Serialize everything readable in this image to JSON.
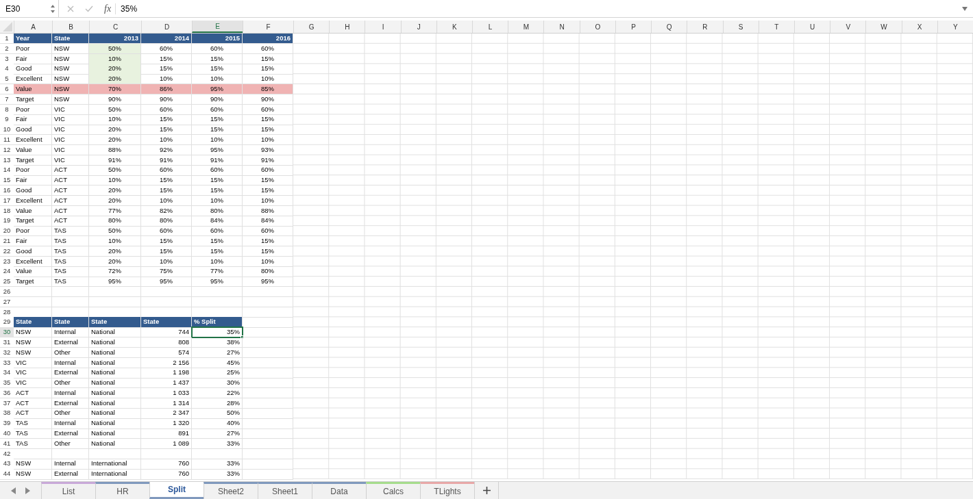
{
  "formula_bar": {
    "name_box": "E30",
    "function_label": "fx",
    "value": "35%"
  },
  "columns": [
    {
      "label": "A",
      "selected": false
    },
    {
      "label": "B",
      "selected": false
    },
    {
      "label": "C",
      "selected": false
    },
    {
      "label": "D",
      "selected": false
    },
    {
      "label": "E",
      "selected": true
    },
    {
      "label": "F",
      "selected": false
    },
    {
      "label": "G",
      "selected": false
    },
    {
      "label": "H",
      "selected": false
    },
    {
      "label": "I",
      "selected": false
    },
    {
      "label": "J",
      "selected": false
    },
    {
      "label": "K",
      "selected": false
    },
    {
      "label": "L",
      "selected": false
    },
    {
      "label": "M",
      "selected": false
    },
    {
      "label": "N",
      "selected": false
    },
    {
      "label": "O",
      "selected": false
    },
    {
      "label": "P",
      "selected": false
    },
    {
      "label": "Q",
      "selected": false
    },
    {
      "label": "R",
      "selected": false
    },
    {
      "label": "S",
      "selected": false
    },
    {
      "label": "T",
      "selected": false
    },
    {
      "label": "U",
      "selected": false
    },
    {
      "label": "V",
      "selected": false
    },
    {
      "label": "W",
      "selected": false
    },
    {
      "label": "X",
      "selected": false
    },
    {
      "label": "Y",
      "selected": false
    }
  ],
  "rows": [
    {
      "n": "1",
      "kind": "header",
      "c_shaded": false,
      "selected": false,
      "cells": [
        "Year",
        "State",
        "2013",
        "2014",
        "2015",
        "2016"
      ]
    },
    {
      "n": "2",
      "kind": "data",
      "c_shaded": true,
      "selected": false,
      "cells": [
        "Poor",
        "NSW",
        "50%",
        "60%",
        "60%",
        "60%"
      ]
    },
    {
      "n": "3",
      "kind": "data",
      "c_shaded": true,
      "selected": false,
      "cells": [
        "Fair",
        "NSW",
        "10%",
        "15%",
        "15%",
        "15%"
      ]
    },
    {
      "n": "4",
      "kind": "data",
      "c_shaded": true,
      "selected": false,
      "cells": [
        "Good",
        "NSW",
        "20%",
        "15%",
        "15%",
        "15%"
      ]
    },
    {
      "n": "5",
      "kind": "data",
      "c_shaded": true,
      "selected": false,
      "cells": [
        "Excellent",
        "NSW",
        "20%",
        "10%",
        "10%",
        "10%"
      ]
    },
    {
      "n": "6",
      "kind": "highlight",
      "c_shaded": false,
      "selected": false,
      "cells": [
        "Value",
        "NSW",
        "70%",
        "86%",
        "95%",
        "85%"
      ]
    },
    {
      "n": "7",
      "kind": "data",
      "c_shaded": false,
      "selected": false,
      "cells": [
        "Target",
        "NSW",
        "90%",
        "90%",
        "90%",
        "90%"
      ]
    },
    {
      "n": "8",
      "kind": "data",
      "c_shaded": false,
      "selected": false,
      "cells": [
        "Poor",
        "VIC",
        "50%",
        "60%",
        "60%",
        "60%"
      ]
    },
    {
      "n": "9",
      "kind": "data",
      "c_shaded": false,
      "selected": false,
      "cells": [
        "Fair",
        "VIC",
        "10%",
        "15%",
        "15%",
        "15%"
      ]
    },
    {
      "n": "10",
      "kind": "data",
      "c_shaded": false,
      "selected": false,
      "cells": [
        "Good",
        "VIC",
        "20%",
        "15%",
        "15%",
        "15%"
      ]
    },
    {
      "n": "11",
      "kind": "data",
      "c_shaded": false,
      "selected": false,
      "cells": [
        "Excellent",
        "VIC",
        "20%",
        "10%",
        "10%",
        "10%"
      ]
    },
    {
      "n": "12",
      "kind": "data",
      "c_shaded": false,
      "selected": false,
      "cells": [
        "Value",
        "VIC",
        "88%",
        "92%",
        "95%",
        "93%"
      ]
    },
    {
      "n": "13",
      "kind": "data",
      "c_shaded": false,
      "selected": false,
      "cells": [
        "Target",
        "VIC",
        "91%",
        "91%",
        "91%",
        "91%"
      ]
    },
    {
      "n": "14",
      "kind": "data",
      "c_shaded": false,
      "selected": false,
      "cells": [
        "Poor",
        "ACT",
        "50%",
        "60%",
        "60%",
        "60%"
      ]
    },
    {
      "n": "15",
      "kind": "data",
      "c_shaded": false,
      "selected": false,
      "cells": [
        "Fair",
        "ACT",
        "10%",
        "15%",
        "15%",
        "15%"
      ]
    },
    {
      "n": "16",
      "kind": "data",
      "c_shaded": false,
      "selected": false,
      "cells": [
        "Good",
        "ACT",
        "20%",
        "15%",
        "15%",
        "15%"
      ]
    },
    {
      "n": "17",
      "kind": "data",
      "c_shaded": false,
      "selected": false,
      "cells": [
        "Excellent",
        "ACT",
        "20%",
        "10%",
        "10%",
        "10%"
      ]
    },
    {
      "n": "18",
      "kind": "data",
      "c_shaded": false,
      "selected": false,
      "cells": [
        "Value",
        "ACT",
        "77%",
        "82%",
        "80%",
        "88%"
      ]
    },
    {
      "n": "19",
      "kind": "data",
      "c_shaded": false,
      "selected": false,
      "cells": [
        "Target",
        "ACT",
        "80%",
        "80%",
        "84%",
        "84%"
      ]
    },
    {
      "n": "20",
      "kind": "data",
      "c_shaded": false,
      "selected": false,
      "cells": [
        "Poor",
        "TAS",
        "50%",
        "60%",
        "60%",
        "60%"
      ]
    },
    {
      "n": "21",
      "kind": "data",
      "c_shaded": false,
      "selected": false,
      "cells": [
        "Fair",
        "TAS",
        "10%",
        "15%",
        "15%",
        "15%"
      ]
    },
    {
      "n": "22",
      "kind": "data",
      "c_shaded": false,
      "selected": false,
      "cells": [
        "Good",
        "TAS",
        "20%",
        "15%",
        "15%",
        "15%"
      ]
    },
    {
      "n": "23",
      "kind": "data",
      "c_shaded": false,
      "selected": false,
      "cells": [
        "Excellent",
        "TAS",
        "20%",
        "10%",
        "10%",
        "10%"
      ]
    },
    {
      "n": "24",
      "kind": "data",
      "c_shaded": false,
      "selected": false,
      "cells": [
        "Value",
        "TAS",
        "72%",
        "75%",
        "77%",
        "80%"
      ]
    },
    {
      "n": "25",
      "kind": "data",
      "c_shaded": false,
      "selected": false,
      "cells": [
        "Target",
        "TAS",
        "95%",
        "95%",
        "95%",
        "95%"
      ]
    },
    {
      "n": "26",
      "kind": "blank",
      "c_shaded": false,
      "selected": false,
      "cells": []
    },
    {
      "n": "27",
      "kind": "blank",
      "c_shaded": false,
      "selected": false,
      "cells": []
    },
    {
      "n": "28",
      "kind": "blank",
      "c_shaded": false,
      "selected": false,
      "cells": []
    },
    {
      "n": "29",
      "kind": "header",
      "c_shaded": false,
      "selected": false,
      "cells": [
        "State",
        "State",
        "State",
        "State",
        "% Split"
      ]
    },
    {
      "n": "30",
      "kind": "data",
      "c_shaded": false,
      "selected": true,
      "cells": [
        "NSW",
        "Internal",
        "National",
        "744",
        "35%"
      ]
    },
    {
      "n": "31",
      "kind": "data",
      "c_shaded": false,
      "selected": false,
      "cells": [
        "NSW",
        "External",
        "National",
        "808",
        "38%"
      ]
    },
    {
      "n": "32",
      "kind": "data",
      "c_shaded": false,
      "selected": false,
      "cells": [
        "NSW",
        "Other",
        "National",
        "574",
        "27%"
      ]
    },
    {
      "n": "33",
      "kind": "data",
      "c_shaded": false,
      "selected": false,
      "cells": [
        "VIC",
        "Internal",
        "National",
        "2 156",
        "45%"
      ]
    },
    {
      "n": "34",
      "kind": "data",
      "c_shaded": false,
      "selected": false,
      "cells": [
        "VIC",
        "External",
        "National",
        "1 198",
        "25%"
      ]
    },
    {
      "n": "35",
      "kind": "data",
      "c_shaded": false,
      "selected": false,
      "cells": [
        "VIC",
        "Other",
        "National",
        "1 437",
        "30%"
      ]
    },
    {
      "n": "36",
      "kind": "data",
      "c_shaded": false,
      "selected": false,
      "cells": [
        "ACT",
        "Internal",
        "National",
        "1 033",
        "22%"
      ]
    },
    {
      "n": "37",
      "kind": "data",
      "c_shaded": false,
      "selected": false,
      "cells": [
        "ACT",
        "External",
        "National",
        "1 314",
        "28%"
      ]
    },
    {
      "n": "38",
      "kind": "data",
      "c_shaded": false,
      "selected": false,
      "cells": [
        "ACT",
        "Other",
        "National",
        "2 347",
        "50%"
      ]
    },
    {
      "n": "39",
      "kind": "data",
      "c_shaded": false,
      "selected": false,
      "cells": [
        "TAS",
        "Internal",
        "National",
        "1 320",
        "40%"
      ]
    },
    {
      "n": "40",
      "kind": "data",
      "c_shaded": false,
      "selected": false,
      "cells": [
        "TAS",
        "External",
        "National",
        "891",
        "27%"
      ]
    },
    {
      "n": "41",
      "kind": "data",
      "c_shaded": false,
      "selected": false,
      "cells": [
        "TAS",
        "Other",
        "National",
        "1 089",
        "33%"
      ]
    },
    {
      "n": "42",
      "kind": "blank",
      "c_shaded": false,
      "selected": false,
      "cells": []
    },
    {
      "n": "43",
      "kind": "data",
      "c_shaded": false,
      "selected": false,
      "cells": [
        "NSW",
        "Internal",
        "International",
        "760",
        "33%"
      ]
    },
    {
      "n": "44",
      "kind": "data",
      "c_shaded": false,
      "selected": false,
      "cells": [
        "NSW",
        "External",
        "International",
        "760",
        "33%"
      ]
    }
  ],
  "sheet_tabs": [
    {
      "label": "List",
      "selected": false,
      "color": "#c9a9d9"
    },
    {
      "label": "HR",
      "selected": false,
      "color": "#8099bd"
    },
    {
      "label": "Split",
      "selected": true,
      "color": "#8099bd"
    },
    {
      "label": "Sheet2",
      "selected": false,
      "color": "#8099bd"
    },
    {
      "label": "Sheet1",
      "selected": false,
      "color": "#8099bd"
    },
    {
      "label": "Data",
      "selected": false,
      "color": "#8099bd"
    },
    {
      "label": "Calcs",
      "selected": false,
      "color": "#a6dc8c"
    },
    {
      "label": "TLights",
      "selected": false,
      "color": "#e8a8a8"
    }
  ]
}
